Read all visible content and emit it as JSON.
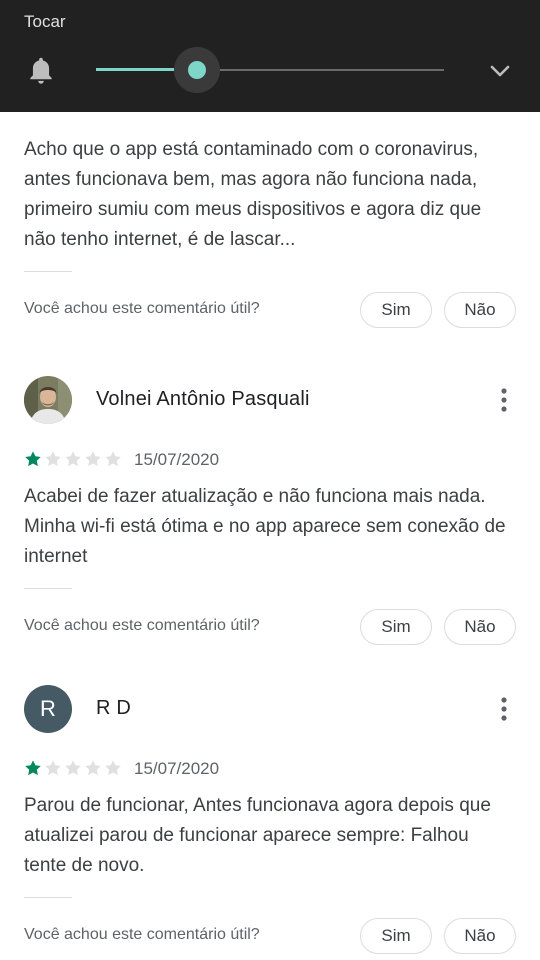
{
  "volume_panel": {
    "title": "Tocar",
    "level": 0.29,
    "accent_color": "#7ed6c8",
    "icons": {
      "left": "bell-icon",
      "right": "chevron-down-icon"
    }
  },
  "reviews": [
    {
      "text": "Acho que o app está contaminado com o coronavirus, antes funcionava bem, mas agora não funciona nada, primeiro sumiu com meus dispositivos e agora diz que não tenho internet, é de lascar...",
      "helpful_question": "Você achou este comentário útil?",
      "yes_label": "Sim",
      "no_label": "Não"
    },
    {
      "author": "Volnei Antônio Pasquali",
      "avatar": "photo",
      "rating": 1,
      "date": "15/07/2020",
      "text": "Acabei de fazer atualização e não funciona mais nada. Minha wi-fi está ótima e no app aparece sem conexão de internet",
      "helpful_question": "Você achou este comentário útil?",
      "yes_label": "Sim",
      "no_label": "Não"
    },
    {
      "author": "R D",
      "avatar_letter": "R",
      "rating": 1,
      "date": "15/07/2020",
      "text": "Parou de funcionar, Antes funcionava agora depois que atualizei parou de funcionar aparece sempre: Falhou tente de novo.",
      "helpful_question": "Você achou este comentário útil?",
      "yes_label": "Sim",
      "no_label": "Não"
    }
  ],
  "colors": {
    "star_filled": "#01875f",
    "star_empty": "#e0e0e0",
    "avatar_letter_bg": "#455a64"
  }
}
